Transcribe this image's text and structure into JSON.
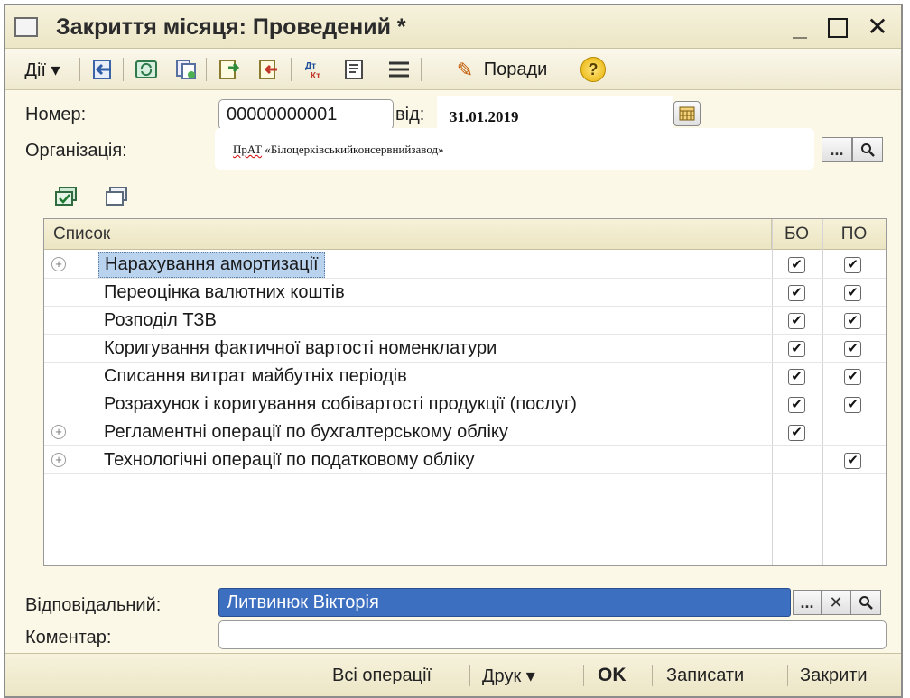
{
  "window": {
    "title": "Закриття місяця: Проведений *",
    "minimize_label": "_",
    "close_label": "✕"
  },
  "toolbar": {
    "actions_label": "Дії ▾",
    "tips_label": "Поради",
    "help_label": "?",
    "icons": [
      "back-icon",
      "refresh-icon",
      "copy-doc-icon",
      "post-doc-icon",
      "unpost-doc-icon",
      "dt-kt-icon",
      "journal-icon",
      "list-settings-icon"
    ]
  },
  "form": {
    "number_label": "Номер:",
    "number_value": "00000000001",
    "date_label": "від:",
    "date_value": "31.01.2019",
    "organization_label": "Організація:",
    "organization_value_prefix": "ПрАТ",
    "organization_value_rest": " «Білоцерківськийконсервнийзавод»",
    "choose_button": "...",
    "search_button": "🔍",
    "responsible_label": "Відповідальний:",
    "responsible_value": "Литвинюк Вікторія",
    "clear_button": "✕",
    "comment_label": "Коментар:",
    "comment_value": ""
  },
  "table": {
    "headers": {
      "list": "Список",
      "bo": "БО",
      "po": "ПО"
    },
    "rows": [
      {
        "label": "Нарахування амортизації",
        "expand": "+",
        "bo": true,
        "po": true,
        "selected": true
      },
      {
        "label": "Переоцінка валютних коштів",
        "expand": "",
        "bo": true,
        "po": true,
        "selected": false
      },
      {
        "label": "Розподіл ТЗВ",
        "expand": "",
        "bo": true,
        "po": true,
        "selected": false
      },
      {
        "label": "Коригування фактичної вартості номенклатури",
        "expand": "",
        "bo": true,
        "po": true,
        "selected": false
      },
      {
        "label": "Списання витрат майбутніх періодів",
        "expand": "",
        "bo": true,
        "po": true,
        "selected": false
      },
      {
        "label": "Розрахунок і коригування собівартості продукції (послуг)",
        "expand": "",
        "bo": true,
        "po": true,
        "selected": false
      },
      {
        "label": "Регламентні операції по бухгалтерському обліку",
        "expand": "+",
        "bo": true,
        "po": false,
        "selected": false
      },
      {
        "label": "Технологічні операції по податковому обліку",
        "expand": "+",
        "bo": false,
        "po": true,
        "selected": false
      }
    ],
    "check_mark": "✔"
  },
  "bottom": {
    "all_operations": "Всі операції",
    "print": "Друк ▾",
    "ok": "OK",
    "save": "Записати",
    "close": "Закрити"
  },
  "colors": {
    "window_bg": "#fbf8e8",
    "selection": "#b9d3ef",
    "responsible_bg": "#3d6fc0"
  }
}
